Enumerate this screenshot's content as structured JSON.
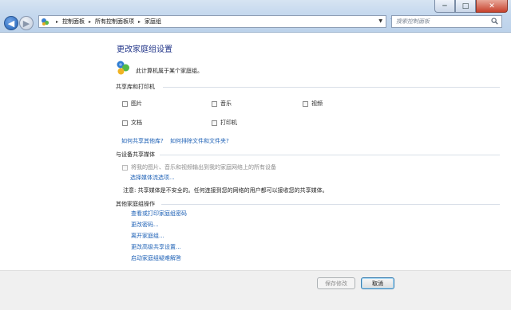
{
  "window": {
    "controls": {
      "minimize": "─",
      "maximize": "□",
      "close": "✕"
    }
  },
  "nav": {
    "breadcrumbs": [
      "控制面板",
      "所有控制面板项",
      "家庭组"
    ],
    "search_placeholder": "搜索控制面板"
  },
  "page": {
    "title": "更改家庭组设置",
    "membership_text": "此计算机属于某个家庭组。"
  },
  "libraries": {
    "heading": "共享库和打印机",
    "items": [
      {
        "label": "图片",
        "checked": false
      },
      {
        "label": "音乐",
        "checked": false
      },
      {
        "label": "视频",
        "checked": false
      },
      {
        "label": "文档",
        "checked": false
      },
      {
        "label": "打印机",
        "checked": false
      }
    ],
    "link_how_share": "如何共享其他库?",
    "link_exclude": "如何排除文件和文件夹?"
  },
  "media": {
    "heading": "与设备共享媒体",
    "stream_label": "将我的图片、音乐和视频输出到我的家庭网络上的所有设备",
    "stream_checked": false,
    "link_options": "选择媒体流选项...",
    "note": "注意: 共享媒体是不安全的。任何连接到您的网络的用户都可以接收您的共享媒体。"
  },
  "other": {
    "heading": "其他家庭组操作",
    "links": [
      "查看或打印家庭组密码",
      "更改密码...",
      "离开家庭组...",
      "更改高级共享设置...",
      "启动家庭组疑难解答"
    ]
  },
  "buttons": {
    "save": "保存修改",
    "cancel": "取消"
  },
  "colors": {
    "link": "#1b5fb5",
    "title": "#1e3287"
  }
}
